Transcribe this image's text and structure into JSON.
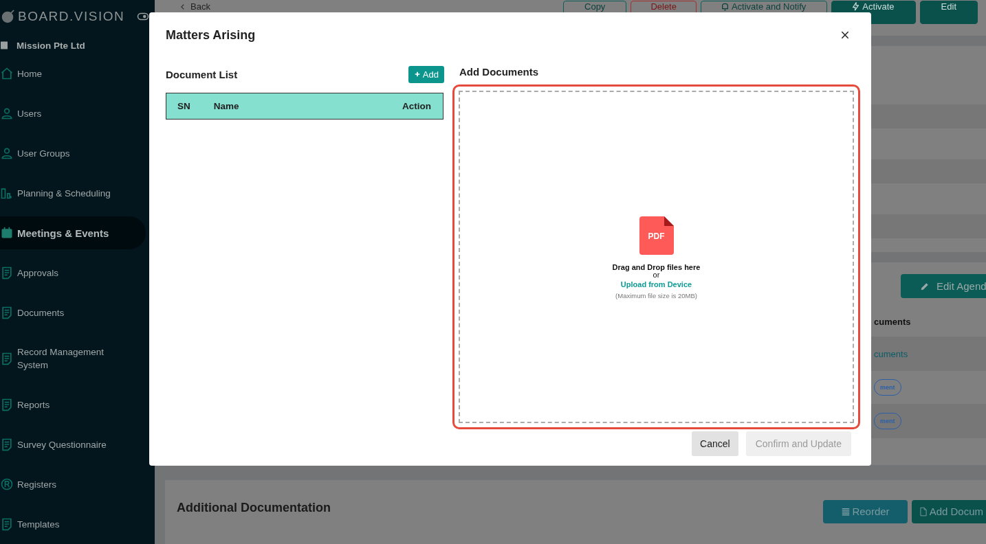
{
  "sidebar": {
    "brand": "BOARD.VISION",
    "company": "Mission Pte Ltd",
    "items": [
      {
        "label": "Home",
        "selected": false
      },
      {
        "label": "Users",
        "selected": false
      },
      {
        "label": "User Groups",
        "selected": false
      },
      {
        "label": "Planning & Scheduling",
        "selected": false
      },
      {
        "label": "Meetings & Events",
        "selected": true
      },
      {
        "label": "Approvals",
        "selected": false
      },
      {
        "label": "Documents",
        "selected": false
      },
      {
        "label": "Record Management System",
        "selected": false
      },
      {
        "label": "Reports",
        "selected": false
      },
      {
        "label": "Survey Questionnaire",
        "selected": false
      },
      {
        "label": "Registers",
        "selected": false
      },
      {
        "label": "Templates",
        "selected": false
      }
    ]
  },
  "page": {
    "back": "Back",
    "actions": [
      {
        "label": "Copy",
        "kind": "outline"
      },
      {
        "label": "Delete",
        "kind": "danger"
      },
      {
        "label": "Activate and Notify",
        "kind": "outline"
      },
      {
        "label": "Activate",
        "kind": "filled"
      },
      {
        "label": "Edit",
        "kind": "filled"
      }
    ],
    "agenda_button": "Edit Agend",
    "agenda_table": {
      "column": "cuments",
      "link": "cuments",
      "pills": [
        "ment",
        "ment"
      ]
    },
    "additional": {
      "title": "Additional Documentation",
      "buttons": [
        "Reorder",
        "Add Docum"
      ]
    }
  },
  "dialog": {
    "title": "Matters Arising",
    "document_list": {
      "title": "Document List",
      "add_button": "Add",
      "columns": [
        "SN",
        "Name",
        "Action"
      ]
    },
    "add_documents": {
      "title": "Add Documents",
      "file_badge": "PDF",
      "drop_text": "Drag and Drop files here",
      "or": "or",
      "upload_link": "Upload from Device",
      "hint": "(Maximum file size is 20MB)"
    },
    "buttons": [
      {
        "label": "Cancel",
        "disabled": false
      },
      {
        "label": "Confirm and Update",
        "disabled": true
      }
    ]
  }
}
